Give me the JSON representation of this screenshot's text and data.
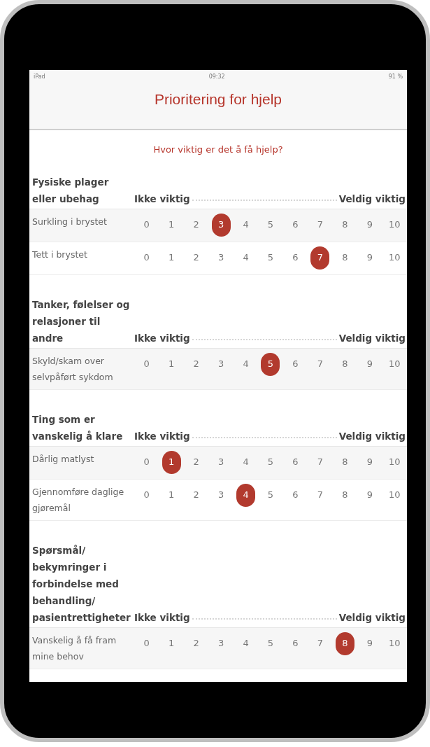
{
  "status_bar": {
    "carrier": "iPad",
    "time": "09:32",
    "battery": "91 %"
  },
  "title": "Prioritering for hjelp",
  "question": "Hvor viktig er det å få hjelp?",
  "sections": [
    {
      "heading": "Fysiske plager eller ubehag",
      "scale_low": "Ikke viktig",
      "scale_high": "Veldig viktig",
      "items": [
        {
          "label": "Surkling i brystet",
          "options": [
            {
              "label": "0",
              "selected": false
            },
            {
              "label": "1",
              "selected": false
            },
            {
              "label": "2",
              "selected": false
            },
            {
              "label": "3",
              "selected": true
            },
            {
              "label": "4",
              "selected": false
            },
            {
              "label": "5",
              "selected": false
            },
            {
              "label": "6",
              "selected": false
            },
            {
              "label": "7",
              "selected": false
            },
            {
              "label": "8",
              "selected": false
            },
            {
              "label": "9",
              "selected": false
            },
            {
              "label": "10",
              "selected": false
            }
          ]
        },
        {
          "label": "Tett i brystet",
          "options": [
            {
              "label": "0",
              "selected": false
            },
            {
              "label": "1",
              "selected": false
            },
            {
              "label": "2",
              "selected": false
            },
            {
              "label": "3",
              "selected": false
            },
            {
              "label": "4",
              "selected": false
            },
            {
              "label": "5",
              "selected": false
            },
            {
              "label": "6",
              "selected": false
            },
            {
              "label": "7",
              "selected": true
            },
            {
              "label": "8",
              "selected": false
            },
            {
              "label": "9",
              "selected": false
            },
            {
              "label": "10",
              "selected": false
            }
          ]
        }
      ]
    },
    {
      "heading": "Tanker, følelser og relasjoner til andre",
      "scale_low": "Ikke viktig",
      "scale_high": "Veldig viktig",
      "items": [
        {
          "label": "Skyld/skam over selvpåført sykdom",
          "options": [
            {
              "label": "0",
              "selected": false
            },
            {
              "label": "1",
              "selected": false
            },
            {
              "label": "2",
              "selected": false
            },
            {
              "label": "3",
              "selected": false
            },
            {
              "label": "4",
              "selected": false
            },
            {
              "label": "5",
              "selected": true
            },
            {
              "label": "6",
              "selected": false
            },
            {
              "label": "7",
              "selected": false
            },
            {
              "label": "8",
              "selected": false
            },
            {
              "label": "9",
              "selected": false
            },
            {
              "label": "10",
              "selected": false
            }
          ]
        }
      ]
    },
    {
      "heading": "Ting som er vanskelig å klare",
      "scale_low": "Ikke viktig",
      "scale_high": "Veldig viktig",
      "items": [
        {
          "label": "Dårlig matlyst",
          "options": [
            {
              "label": "0",
              "selected": false
            },
            {
              "label": "1",
              "selected": true
            },
            {
              "label": "2",
              "selected": false
            },
            {
              "label": "3",
              "selected": false
            },
            {
              "label": "4",
              "selected": false
            },
            {
              "label": "5",
              "selected": false
            },
            {
              "label": "6",
              "selected": false
            },
            {
              "label": "7",
              "selected": false
            },
            {
              "label": "8",
              "selected": false
            },
            {
              "label": "9",
              "selected": false
            },
            {
              "label": "10",
              "selected": false
            }
          ]
        },
        {
          "label": "Gjennomføre daglige gjøremål",
          "options": [
            {
              "label": "0",
              "selected": false
            },
            {
              "label": "1",
              "selected": false
            },
            {
              "label": "2",
              "selected": false
            },
            {
              "label": "3",
              "selected": false
            },
            {
              "label": "4",
              "selected": true
            },
            {
              "label": "5",
              "selected": false
            },
            {
              "label": "6",
              "selected": false
            },
            {
              "label": "7",
              "selected": false
            },
            {
              "label": "8",
              "selected": false
            },
            {
              "label": "9",
              "selected": false
            },
            {
              "label": "10",
              "selected": false
            }
          ]
        }
      ]
    },
    {
      "heading": "Spørsmål/ bekymringer i forbindelse med behandling/ pasientrettigheter",
      "scale_low": "Ikke viktig",
      "scale_high": "Veldig viktig",
      "items": [
        {
          "label": "Vanskelig å få fram mine behov",
          "options": [
            {
              "label": "0",
              "selected": false
            },
            {
              "label": "1",
              "selected": false
            },
            {
              "label": "2",
              "selected": false
            },
            {
              "label": "3",
              "selected": false
            },
            {
              "label": "4",
              "selected": false
            },
            {
              "label": "5",
              "selected": false
            },
            {
              "label": "6",
              "selected": false
            },
            {
              "label": "7",
              "selected": false
            },
            {
              "label": "8",
              "selected": true
            },
            {
              "label": "9",
              "selected": false
            },
            {
              "label": "10",
              "selected": false
            }
          ]
        }
      ]
    }
  ]
}
